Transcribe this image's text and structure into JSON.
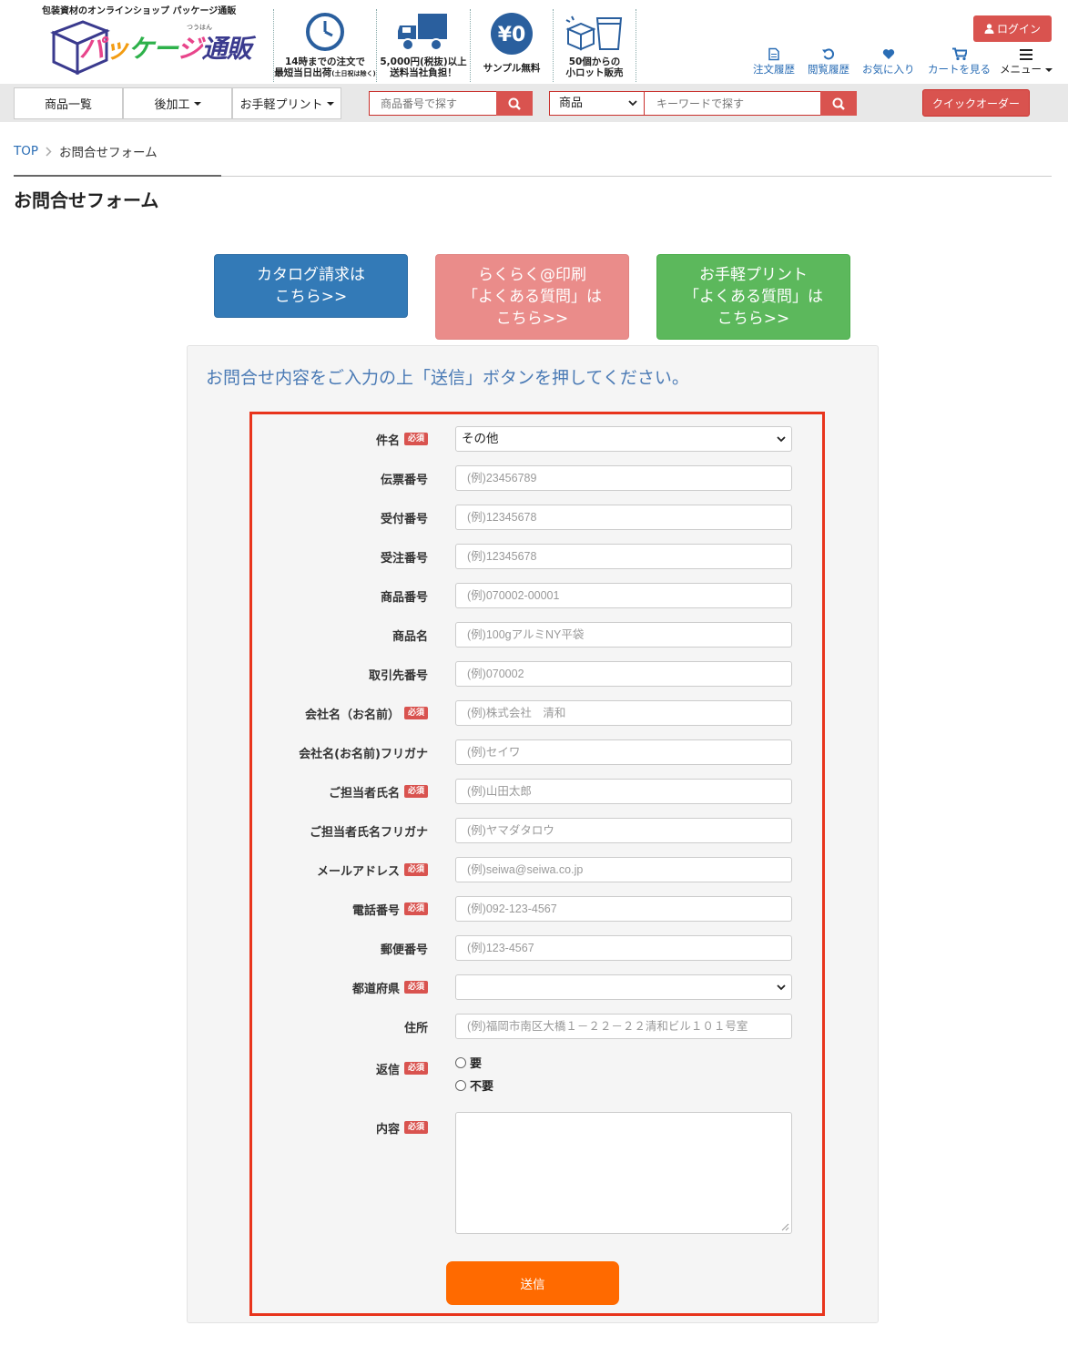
{
  "header": {
    "tagline": "包装資材のオンラインショップ パッケージ通販",
    "logo": {
      "chars": [
        "パ",
        "ッ",
        "ケー",
        "ジ",
        "通販"
      ],
      "ruby": "つうはん"
    },
    "features": [
      {
        "icon": "clock-icon",
        "line1": "14時までの注文で",
        "line2": "最短当日出荷",
        "note": "(土日祝は除く)"
      },
      {
        "icon": "truck-icon",
        "line1": "5,000円(税抜)以上",
        "line2": "送料当社負担！"
      },
      {
        "icon": "yen-zero-icon",
        "badge": "¥0",
        "line1": "サンプル無料"
      },
      {
        "icon": "small-lot-icon",
        "line1": "50個からの",
        "line2": "小ロット販売"
      }
    ],
    "login_label": "ログイン",
    "nav": [
      {
        "icon": "document-icon",
        "label": "注文履歴"
      },
      {
        "icon": "history-icon",
        "label": "閲覧履歴"
      },
      {
        "icon": "heart-icon",
        "label": "お気に入り"
      },
      {
        "icon": "cart-icon",
        "label": "カートを見る"
      },
      {
        "icon": "hamburger-icon",
        "label": "メニュー"
      }
    ]
  },
  "toolbar": {
    "items": [
      "商品一覧",
      "後加工",
      "お手軽プリント"
    ],
    "search_number_placeholder": "商品番号で探す",
    "category_select": "商品",
    "keyword_placeholder": "キーワードで探す",
    "quick_order": "クイックオーダー"
  },
  "breadcrumb": {
    "home": "TOP",
    "current": "お問合せフォーム"
  },
  "page_title": "お問合せフォーム",
  "links": {
    "catalog": "カタログ請求は\nこちら>>",
    "easy_print_faq": "らくらく@印刷\n「よくある質問」は\nこちら>>",
    "handy_print_faq": "お手軽プリント\n「よくある質問」は\nこちら>>"
  },
  "form": {
    "lead": "お問合せ内容をご入力の上「送信」ボタンを押してください。",
    "required_badge": "必須",
    "fields": [
      {
        "label": "件名",
        "required": true,
        "type": "select",
        "value": "その他"
      },
      {
        "label": "伝票番号",
        "required": false,
        "type": "text",
        "placeholder": "(例)23456789"
      },
      {
        "label": "受付番号",
        "required": false,
        "type": "text",
        "placeholder": "(例)12345678"
      },
      {
        "label": "受注番号",
        "required": false,
        "type": "text",
        "placeholder": "(例)12345678"
      },
      {
        "label": "商品番号",
        "required": false,
        "type": "text",
        "placeholder": "(例)070002-00001"
      },
      {
        "label": "商品名",
        "required": false,
        "type": "text",
        "placeholder": "(例)100gアルミNY平袋"
      },
      {
        "label": "取引先番号",
        "required": false,
        "type": "text",
        "placeholder": "(例)070002"
      },
      {
        "label": "会社名（お名前）",
        "required": true,
        "type": "text",
        "placeholder": "(例)株式会社　清和"
      },
      {
        "label": "会社名(お名前)フリガナ",
        "required": false,
        "type": "text",
        "placeholder": "(例)セイワ"
      },
      {
        "label": "ご担当者氏名",
        "required": true,
        "type": "text",
        "placeholder": "(例)山田太郎"
      },
      {
        "label": "ご担当者氏名フリガナ",
        "required": false,
        "type": "text",
        "placeholder": "(例)ヤマダタロウ"
      },
      {
        "label": "メールアドレス",
        "required": true,
        "type": "text",
        "placeholder": "(例)seiwa@seiwa.co.jp"
      },
      {
        "label": "電話番号",
        "required": true,
        "type": "text",
        "placeholder": "(例)092-123-4567"
      },
      {
        "label": "郵便番号",
        "required": false,
        "type": "text",
        "placeholder": "(例)123-4567"
      },
      {
        "label": "都道府県",
        "required": true,
        "type": "select",
        "value": ""
      },
      {
        "label": "住所",
        "required": false,
        "type": "text",
        "placeholder": "(例)福岡市南区大橋１－２２－２２清和ビル１０１号室"
      }
    ],
    "reply": {
      "label": "返信",
      "required": true,
      "options": [
        "要",
        "不要"
      ]
    },
    "content": {
      "label": "内容",
      "required": true
    },
    "submit_label": "送信"
  },
  "colors": {
    "accent_red": "#d9534f",
    "link_blue": "#2a6db5",
    "catalog_blue": "#337ab7",
    "faq_pink": "#ea8c8a",
    "faq_green": "#5cb85c",
    "submit_orange": "#ff6a00",
    "highlight_frame": "#e8341c"
  }
}
